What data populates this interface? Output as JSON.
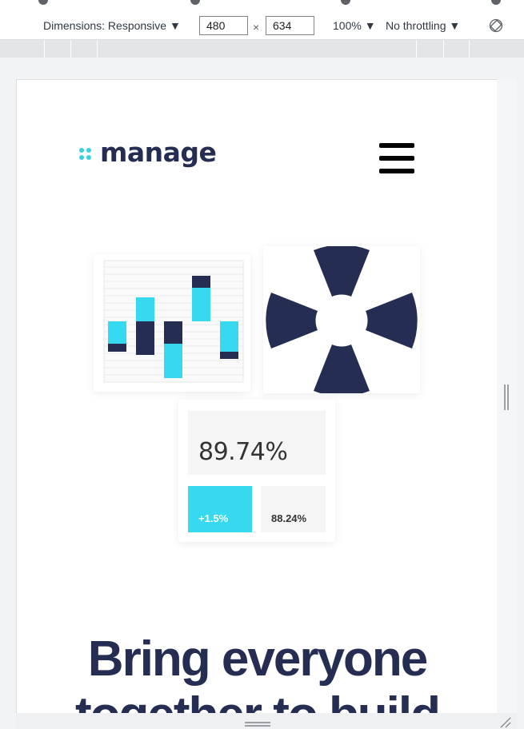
{
  "devtools": {
    "dimensions_label": "Dimensions: Responsive ▼",
    "width_value": "480",
    "times_sign": "×",
    "height_value": "634",
    "zoom_label": "100% ▼",
    "throttling_label": "No throttling ▼",
    "rotate_icon": "rotate-icon"
  },
  "page": {
    "logo_text": "manage",
    "menu_icon": "hamburger-icon",
    "stat_main": "89.74%",
    "stat_change": "+1.5%",
    "stat_secondary": "88.24%",
    "headline": "Bring everyone together to build"
  },
  "colors": {
    "navy": "#252e52",
    "cyan": "#36d9ef",
    "logo_dots": "#36d1e6"
  }
}
